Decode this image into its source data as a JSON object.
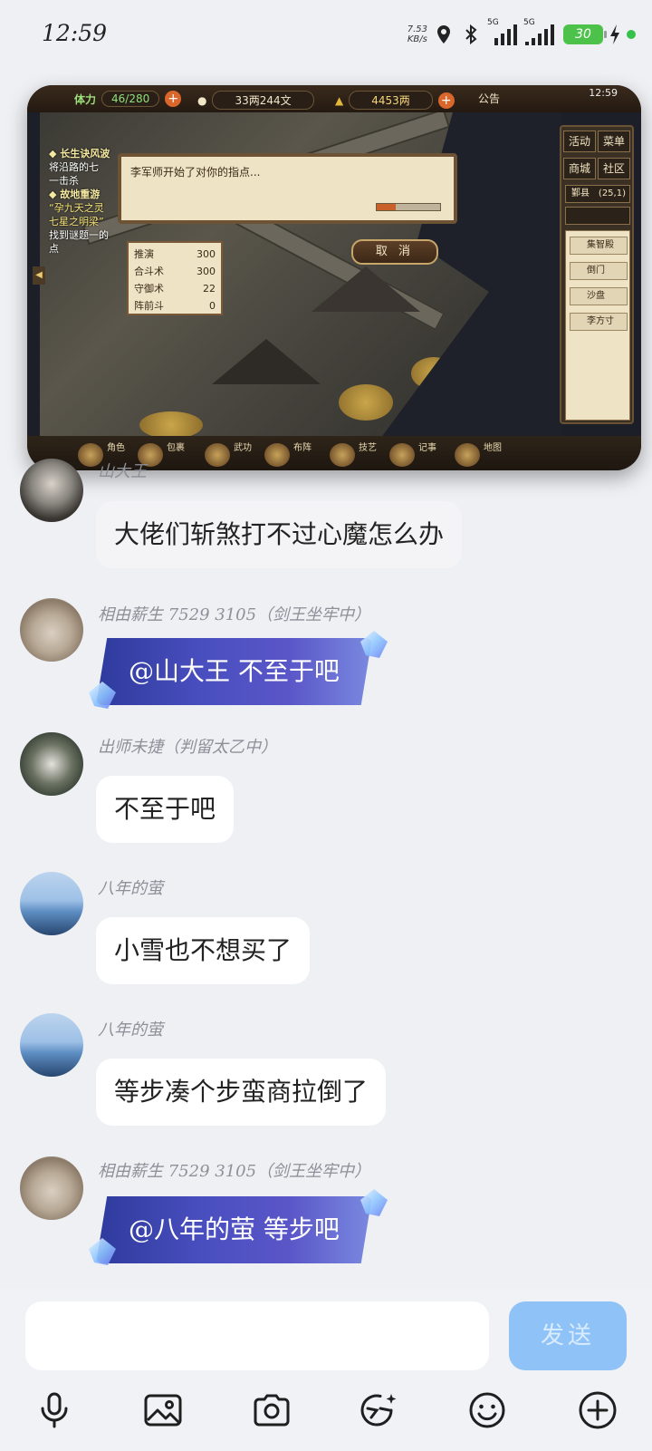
{
  "status_bar": {
    "time": "12:59",
    "net_speed_value": "7.53",
    "net_speed_unit": "KB/s",
    "signal_1": "5G",
    "signal_2": "5G",
    "battery": "30"
  },
  "game": {
    "stamina_label": "体力",
    "stamina_value": "46/280",
    "money": "33两244文",
    "gold": "4453两",
    "notice": "公告",
    "clock": "12:59",
    "quest_1_title": "◆ 长生诀风波",
    "quest_1_text": "将沿路的七",
    "quest_1_text2": "一击杀",
    "quest_2_title": "◆ 故地重游",
    "quest_2_hl": "“孕九天之灵",
    "quest_2_hl2": "七星之明梁”",
    "quest_2_text": "找到谜题一的",
    "quest_2_text2": "点",
    "dialog_text": "李军师开始了对你的指点...",
    "dialog_progress": 0.3,
    "cancel": "取 消",
    "stats": [
      {
        "name": "推演",
        "value": "300"
      },
      {
        "name": "合斗术",
        "value": "300"
      },
      {
        "name": "守御术",
        "value": "22"
      },
      {
        "name": "阵前斗",
        "value": "0"
      }
    ],
    "side_buttons": [
      "活动",
      "菜单",
      "商城",
      "社区"
    ],
    "location_name": "鄞县",
    "location_coord": "(25,1)",
    "side_list": [
      "集智殿",
      "倒门",
      "沙盘",
      "李方寸"
    ],
    "bottom_items": [
      "角色",
      "包裹",
      "武功",
      "布阵",
      "技艺",
      "记事",
      "地图"
    ]
  },
  "messages": [
    {
      "sender": "山大王",
      "text": "大佬们斩煞打不过心魔怎么办"
    },
    {
      "sender": "相由薪生 7529 3105（剑王坐牢中）",
      "text": "@山大王 不至于吧"
    },
    {
      "sender": "出师未捷（判留太乙中）",
      "text": "不至于吧"
    },
    {
      "sender": "八年的萤",
      "text": "小雪也不想买了"
    },
    {
      "sender": "八年的萤",
      "text": "等步凑个步蛮商拉倒了"
    },
    {
      "sender": "相由薪生 7529 3105（剑王坐牢中）",
      "text": "@八年的萤 等步吧"
    }
  ],
  "input": {
    "placeholder": "",
    "send_label": "发送"
  },
  "icons": [
    "microphone-icon",
    "image-icon",
    "camera-icon",
    "sticker-icon",
    "emoji-icon",
    "plus-icon"
  ]
}
